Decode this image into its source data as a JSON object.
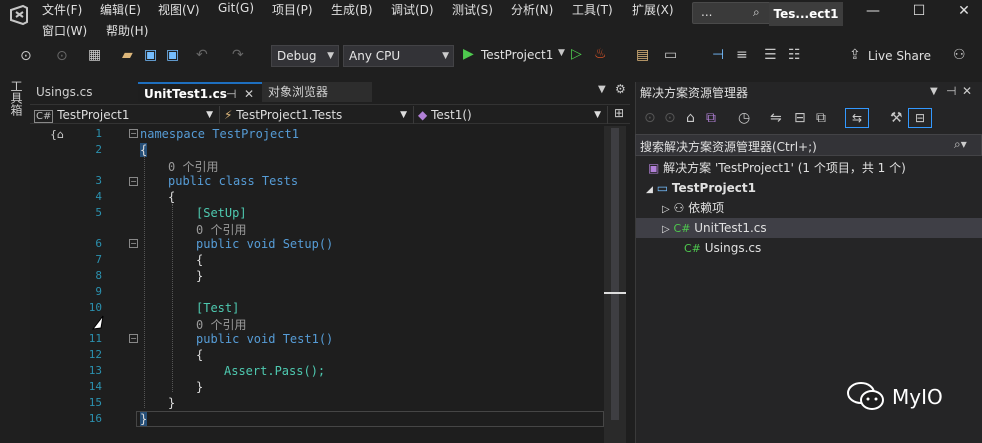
{
  "menu": {
    "row1": [
      "文件(F)",
      "编辑(E)",
      "视图(V)",
      "Git(G)",
      "项目(P)",
      "生成(B)",
      "调试(D)",
      "测试(S)",
      "分析(N)",
      "工具(T)",
      "扩展(X)"
    ],
    "row2": [
      "窗口(W)",
      "帮助(H)"
    ]
  },
  "title_search": {
    "label": "..."
  },
  "title_pill": "Tes...ect1",
  "window_controls": {
    "minimize": "—",
    "maximize": "☐",
    "close": "✕"
  },
  "toolbar": {
    "config": "Debug",
    "platform": "Any CPU",
    "run_target": "TestProject1",
    "live_share": "Live Share"
  },
  "left_sidebar": {
    "label": "工具箱"
  },
  "tabs": [
    {
      "label": "Usings.cs"
    },
    {
      "label": "UnitTest1.cs",
      "pin": "⊣",
      "close": "✕"
    },
    {
      "label": "对象浏览器"
    }
  ],
  "navbar": {
    "project": "TestProject1",
    "scope": "TestProject1.Tests",
    "member": "Test1()"
  },
  "code": {
    "line_numbers": [
      "1",
      "2",
      "3",
      "4",
      "5",
      "6",
      "7",
      "8",
      "9",
      "10",
      "11",
      "12",
      "13",
      "14",
      "15",
      "16"
    ],
    "lines": {
      "l1": "namespace TestProject1",
      "l2": "{",
      "ref1": "0 个引用",
      "l3": "public class Tests",
      "l4": "{",
      "l5": "[SetUp]",
      "ref2": "0 个引用",
      "l6": "public void Setup()",
      "l7": "{",
      "l8": "}",
      "l10": "[Test]",
      "ref3": "0 个引用",
      "l11": "public void Test1()",
      "l12": "{",
      "l13": "Assert.Pass();",
      "l14": "}",
      "l15": "}",
      "l16": "}"
    }
  },
  "solution_explorer": {
    "title": "解决方案资源管理器",
    "search_placeholder": "搜索解决方案资源管理器(Ctrl+;)",
    "items": [
      {
        "label": "解决方案 'TestProject1' (1 个项目，共 1 个)"
      },
      {
        "label": "TestProject1"
      },
      {
        "label": "依赖项"
      },
      {
        "label": "UnitTest1.cs"
      },
      {
        "label": "Usings.cs"
      }
    ]
  },
  "watermark": "MyIO",
  "colors": {
    "accent": "#1e6fbf",
    "background": "#1e1e1e",
    "keyword": "#569cd6",
    "type": "#4ec9b0"
  }
}
